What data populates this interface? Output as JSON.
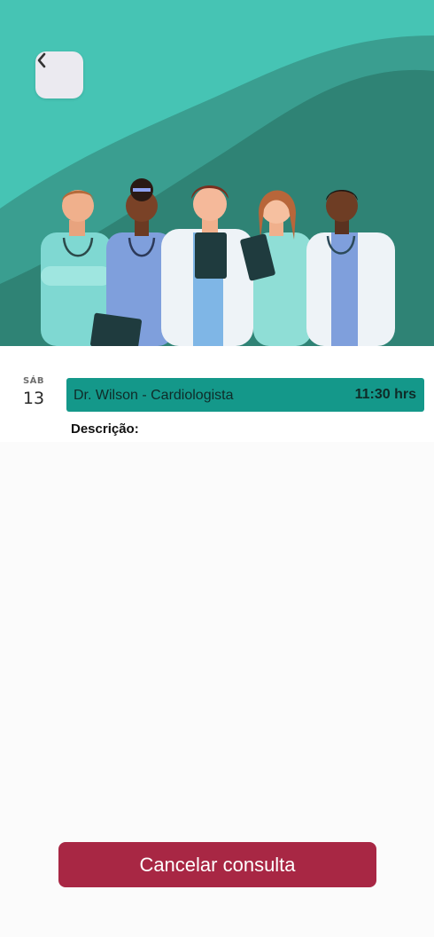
{
  "header": {
    "back_icon": "chevron-left-icon"
  },
  "hero": {
    "image": "medical-team-illustration"
  },
  "appointment": {
    "day_name": "SÁB",
    "day_number": "13",
    "title": "Dr. Wilson - Cardiologista",
    "time": "11:30 hrs",
    "description_label": "Descrição:"
  },
  "actions": {
    "cancel_label": "Cancelar consulta"
  },
  "colors": {
    "hero_bg": "#46c4b4",
    "card_bg": "#14988a",
    "cancel_bg": "#a82744"
  }
}
